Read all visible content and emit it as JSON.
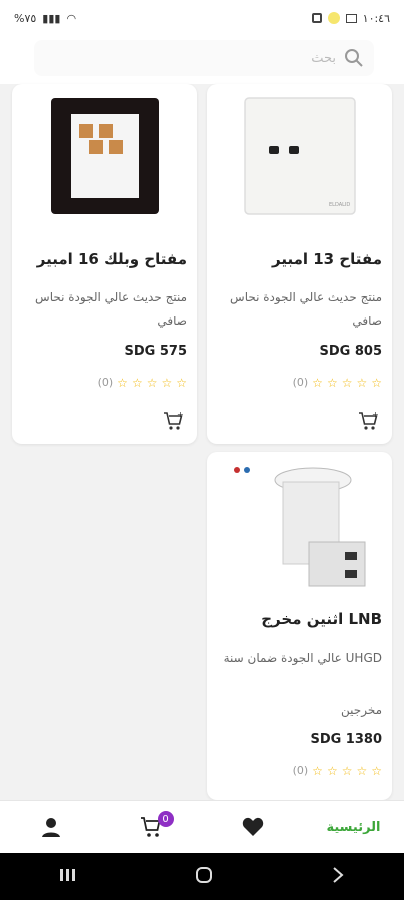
{
  "status_bar": {
    "time": "١٠:٤٦",
    "battery": "%٧٥"
  },
  "search": {
    "placeholder": "بحث"
  },
  "products": [
    {
      "title": "مفتاح 13 امبير",
      "description": "منتج حديث عالي الجودة نحاس صافي",
      "price": "SDG 805",
      "rating_count": "(0)",
      "image_label": "ELDALID"
    },
    {
      "title": "مفتاح وبلك 16 امبير",
      "description": "منتج حديث عالي الجودة نحاس صافي",
      "price": "SDG 575",
      "rating_count": "(0)"
    },
    {
      "title": "LNB اثنين مخرج",
      "description": "UHGD عالي الجودة ضمان سنة",
      "description_extra": "مخرجين",
      "price": "SDG 1380",
      "rating_count": "(0)"
    }
  ],
  "bottom_nav": {
    "home_label": "الرئيسية",
    "cart_count": "0",
    "icons": [
      "heart-icon",
      "cart-icon",
      "user-icon"
    ]
  },
  "colors": {
    "accent_green": "#3da73a",
    "badge_purple": "#8e2fc4",
    "star_yellow": "#f2b90d"
  }
}
